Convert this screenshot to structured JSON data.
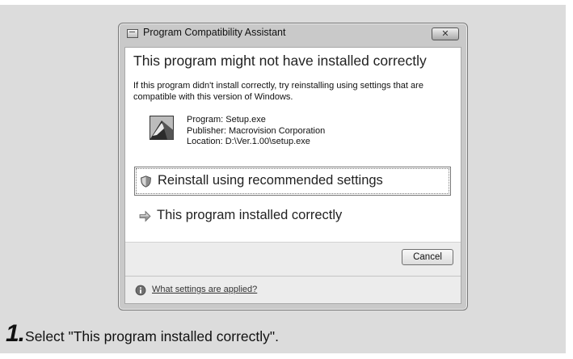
{
  "dialog": {
    "title": "Program Compatibility Assistant",
    "close_icon": "close-icon",
    "heading": "This program might not have installed correctly",
    "description": "If this program didn't install correctly, try reinstalling using settings that are compatible with this version of Windows.",
    "program": {
      "icon": "setup-program-icon",
      "name": "Program: Setup.exe",
      "publisher": "Publisher: Macrovision Corporation",
      "location": "Location: D:\\Ver.1.00\\setup.exe"
    },
    "options": [
      {
        "label": "Reinstall using recommended settings",
        "icon": "shield-icon"
      },
      {
        "label": "This program installed correctly",
        "icon": "arrow-icon"
      }
    ],
    "cancel_label": "Cancel",
    "footer_link": "What settings are applied?",
    "footer_icon": "info-icon"
  },
  "instruction": {
    "step_number": "1.",
    "text": "Select \"This program installed correctly\"."
  }
}
